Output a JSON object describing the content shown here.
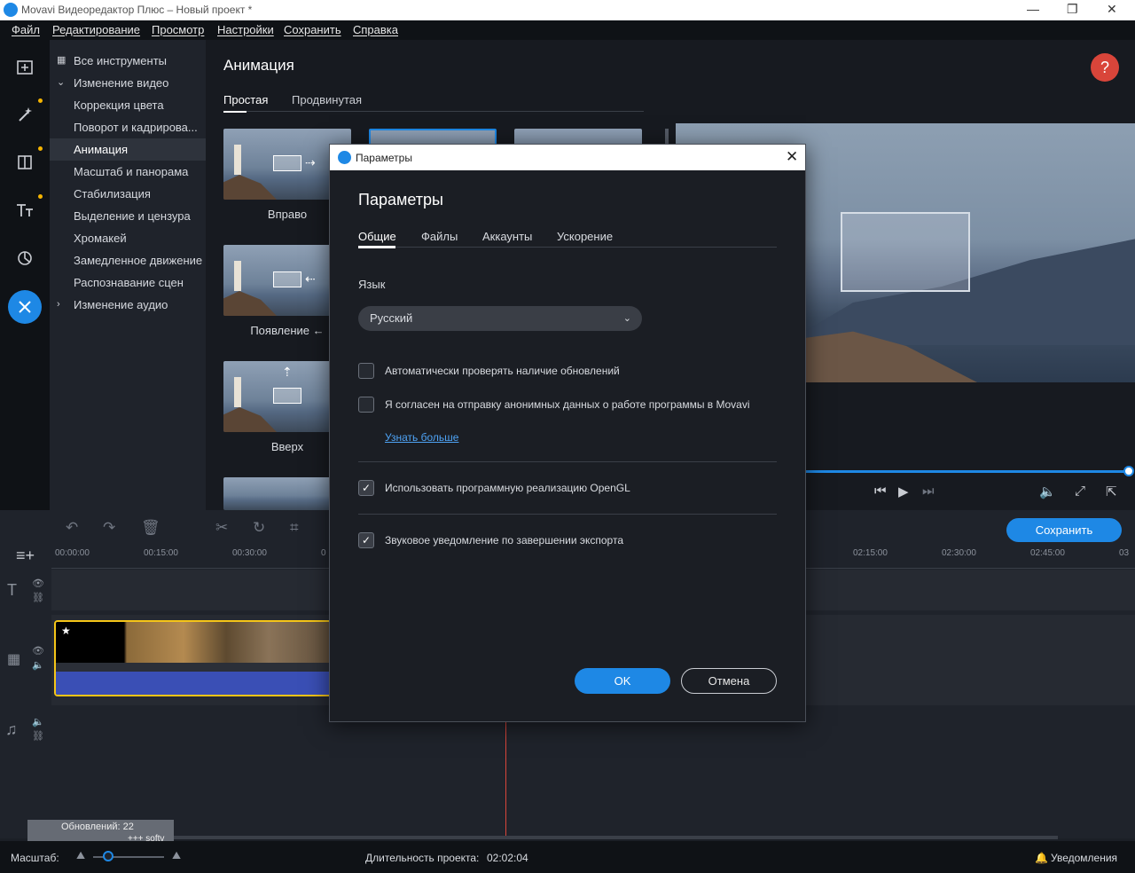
{
  "window": {
    "title": "Movavi Видеоредактор Плюс – Новый проект *",
    "controls": [
      "—",
      "❐",
      "✕"
    ]
  },
  "menu": [
    "Файл",
    "Редактирование",
    "Просмотр",
    "Настройки",
    "Сохранить",
    "Справка"
  ],
  "rail": {
    "icons": [
      "import-icon",
      "magic-wand-icon",
      "filters-icon",
      "titles-icon",
      "transitions-icon",
      "tools-icon"
    ],
    "accent": "#1e88e5",
    "dot_color": "#f5b400"
  },
  "tools": {
    "items": [
      {
        "label": "Все инструменты",
        "caret": "grid"
      },
      {
        "label": "Изменение видео",
        "caret": "down"
      },
      {
        "label": "Коррекция цвета"
      },
      {
        "label": "Поворот и кадрирова..."
      },
      {
        "label": "Анимация",
        "active": true
      },
      {
        "label": "Масштаб и панорама"
      },
      {
        "label": "Стабилизация"
      },
      {
        "label": "Выделение и цензура"
      },
      {
        "label": "Хромакей"
      },
      {
        "label": "Замедленное движение"
      },
      {
        "label": "Распознавание сцен"
      },
      {
        "label": "Изменение аудио",
        "caret": "right"
      }
    ]
  },
  "animation_panel": {
    "title": "Анимация",
    "tabs": [
      "Простая",
      "Продвинутая"
    ],
    "items": [
      "Вправо",
      "Появление ←",
      "Вверх"
    ]
  },
  "preview": {
    "help": "?"
  },
  "timeline": {
    "save_label": "Сохранить",
    "ruler": [
      "00:00:00",
      "00:15:00",
      "00:30:00",
      "0",
      "02:15:00",
      "02:30:00",
      "02:45:00",
      "03"
    ],
    "updates_badge": "Обновлений: 22",
    "badge_sub": "+++ softv"
  },
  "status": {
    "zoom_label": "Масштаб:",
    "duration_label": "Длительность проекта:",
    "duration_value": "02:02:04",
    "notifications": "Уведомления"
  },
  "dialog": {
    "window_title": "Параметры",
    "heading": "Параметры",
    "tabs": [
      "Общие",
      "Файлы",
      "Аккаунты",
      "Ускорение"
    ],
    "language_label": "Язык",
    "language_value": "Русский",
    "options": [
      {
        "label": "Автоматически проверять наличие обновлений",
        "checked": false
      },
      {
        "label": "Я согласен на отправку анонимных данных о работе программы в Movavi",
        "checked": false
      },
      {
        "label": "Использовать программную реализацию OpenGL",
        "checked": true
      },
      {
        "label": "Звуковое уведомление по завершении экспорта",
        "checked": true
      }
    ],
    "learn_more": "Узнать больше",
    "ok": "OK",
    "cancel": "Отмена"
  }
}
